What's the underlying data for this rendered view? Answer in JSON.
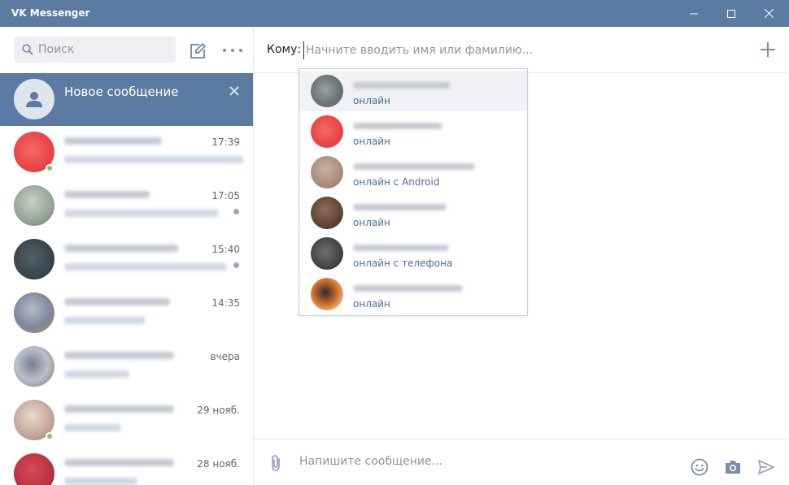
{
  "window": {
    "title": "VK Messenger"
  },
  "sidebar": {
    "search_placeholder": "Поиск",
    "new_message_label": "Новое сообщение",
    "conversations": [
      {
        "time": "17:39",
        "online": true,
        "unread": false
      },
      {
        "time": "17:05",
        "online": false,
        "unread": true
      },
      {
        "time": "15:40",
        "online": false,
        "unread": true
      },
      {
        "time": "14:35",
        "online": false,
        "unread": false
      },
      {
        "time": "вчера",
        "online": false,
        "unread": false
      },
      {
        "time": "29 нояб.",
        "online": true,
        "unread": false
      },
      {
        "time": "28 нояб.",
        "online": false,
        "unread": false
      }
    ]
  },
  "main": {
    "to_label": "Кому:",
    "to_placeholder": "Начните вводить имя или фамилию...",
    "composer_placeholder": "Напишите сообщение...",
    "suggestions": [
      {
        "status": "онлайн"
      },
      {
        "status": "онлайн"
      },
      {
        "status": "онлайн с Android"
      },
      {
        "status": "онлайн"
      },
      {
        "status": "онлайн с телефона"
      },
      {
        "status": "онлайн"
      }
    ]
  },
  "colors": {
    "accent": "#5b7ba3",
    "status_text": "#4a6e98",
    "online_dot": "#8ac176"
  },
  "icons": [
    "search-icon",
    "compose-icon",
    "more-icon",
    "close-icon",
    "plus-icon",
    "attach-icon",
    "smile-icon",
    "camera-icon",
    "send-icon",
    "minimize-icon",
    "maximize-icon",
    "window-close-icon",
    "user-placeholder-icon"
  ]
}
